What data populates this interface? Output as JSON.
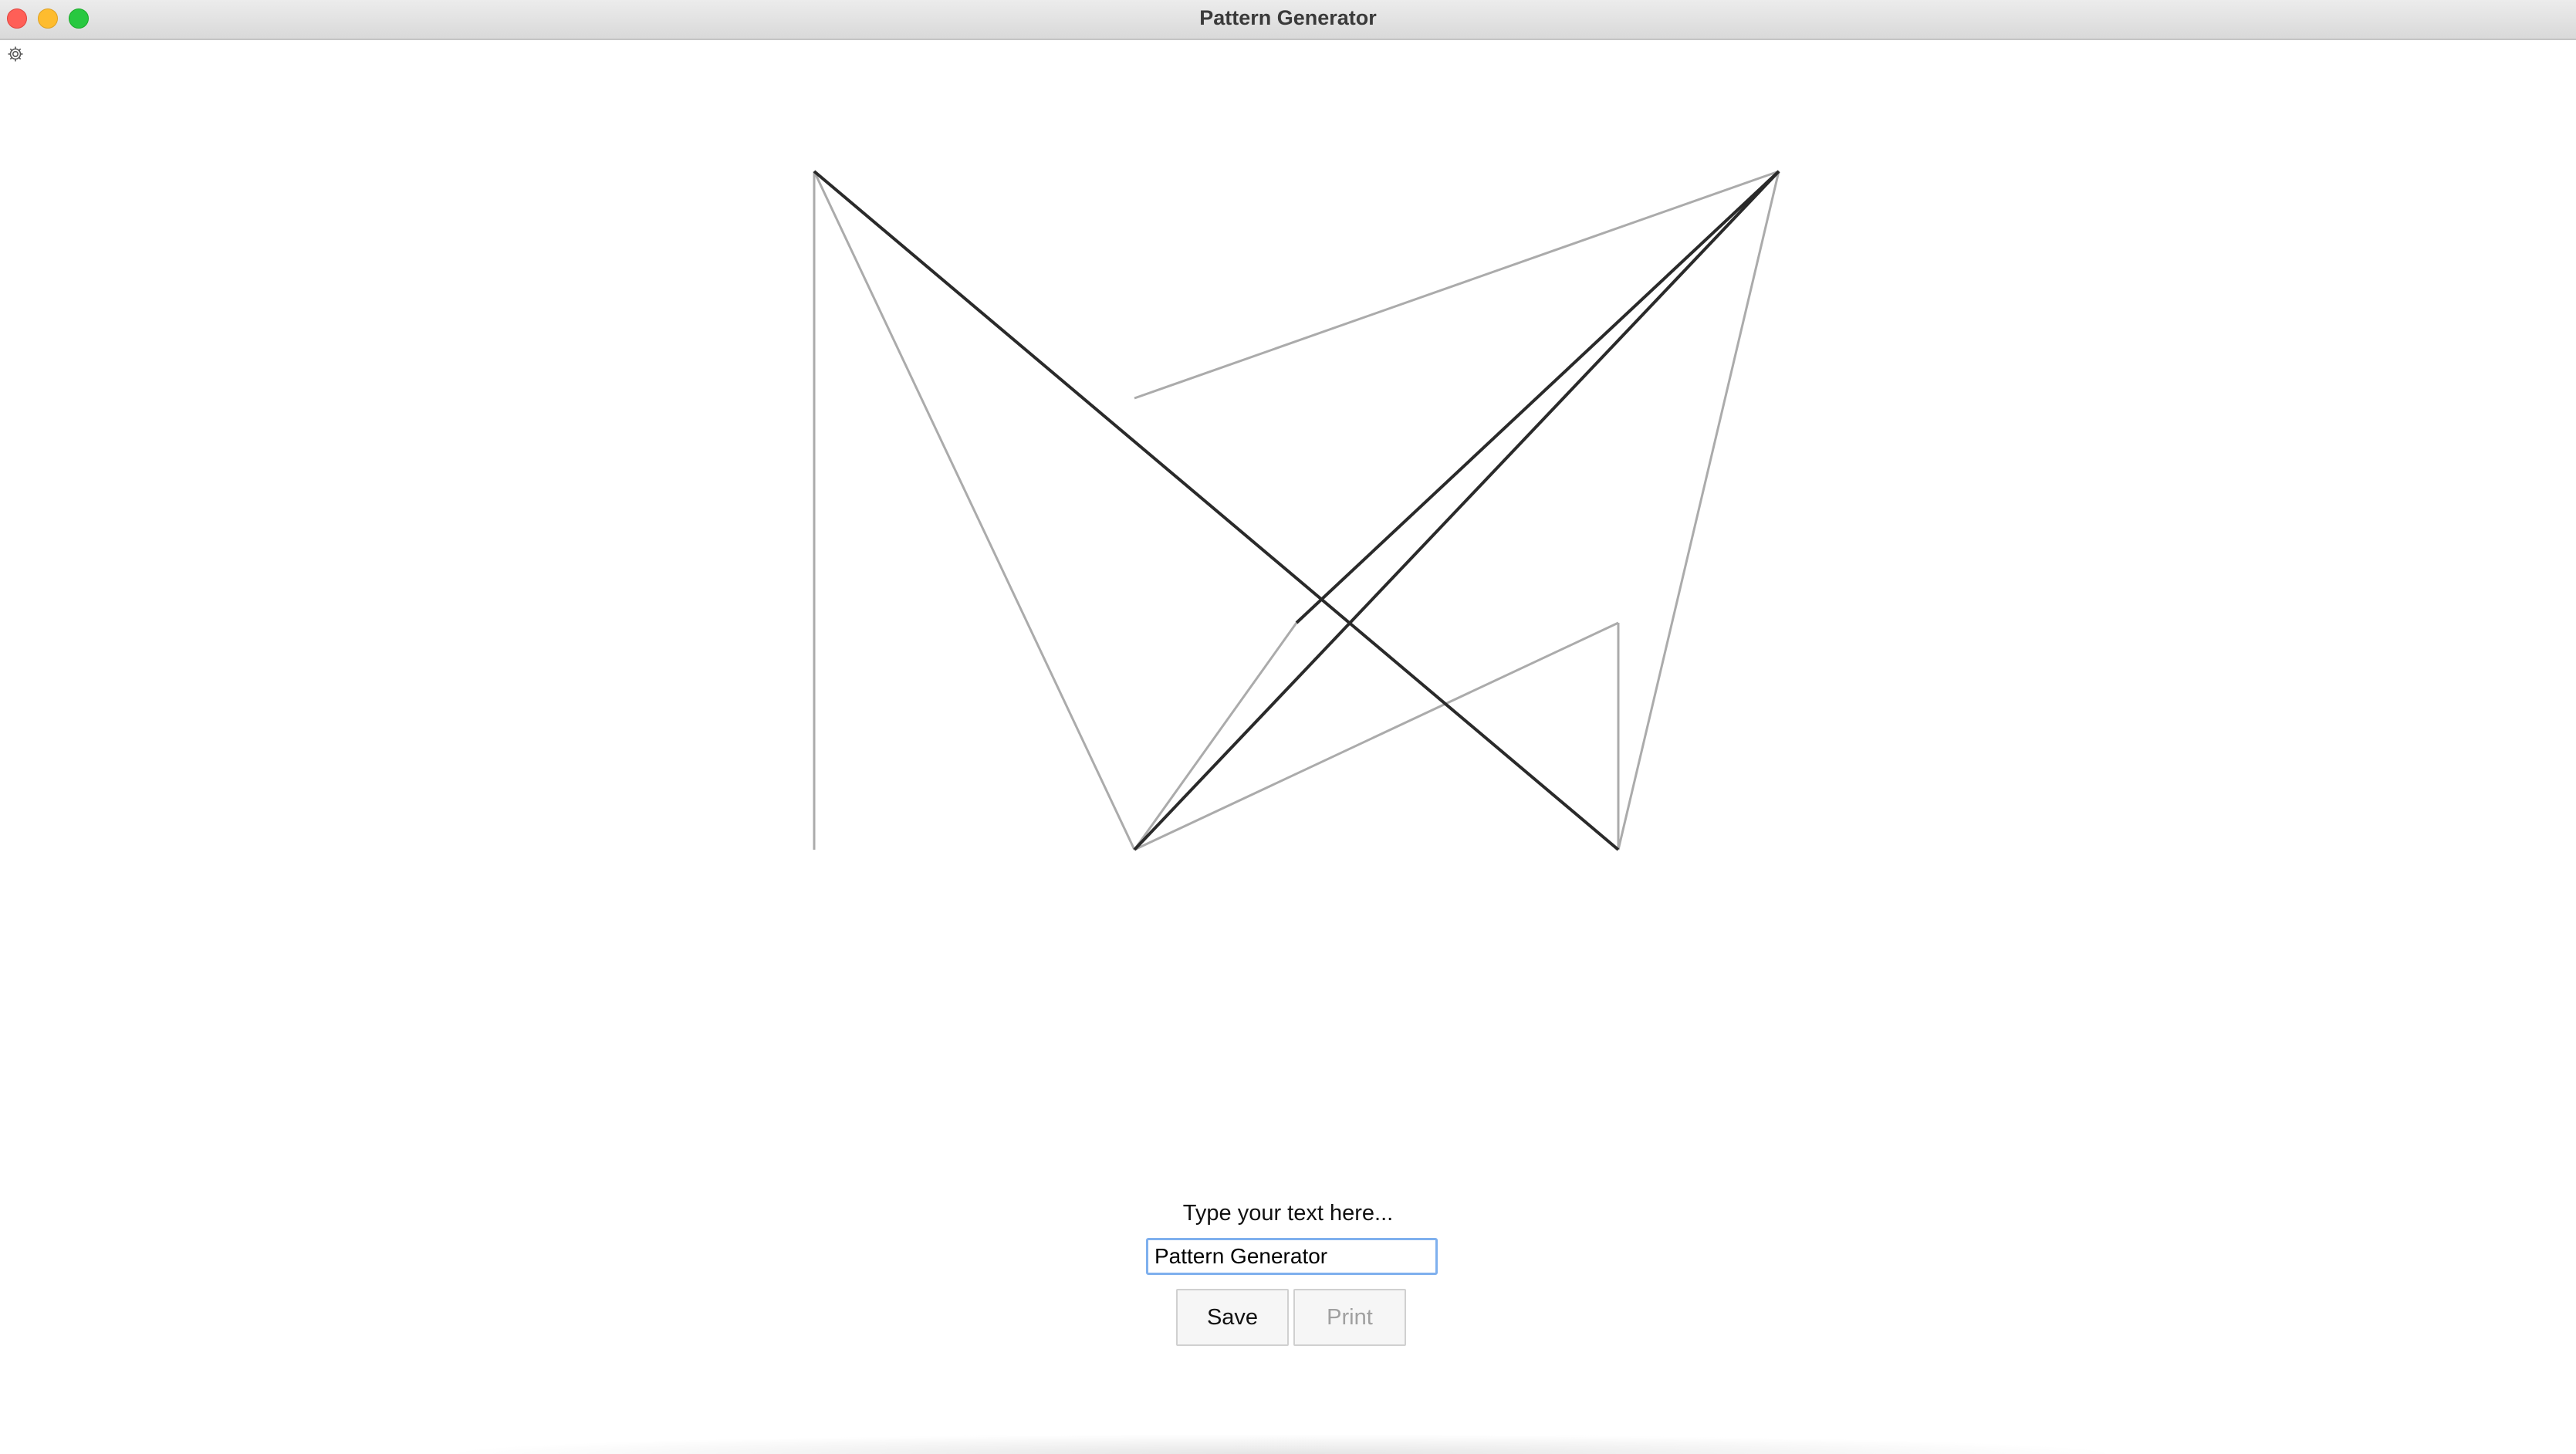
{
  "window": {
    "title": "Pattern Generator"
  },
  "toolbar": {
    "settings_icon": "gear-icon"
  },
  "pattern": {
    "stroke_dark": "#2a2a2a",
    "stroke_light": "#ababab"
  },
  "form": {
    "prompt_label": "Type your text here...",
    "input_value": "Pattern Generator",
    "save_label": "Save",
    "print_label": "Print",
    "focus_color": "#7fb0ee"
  }
}
